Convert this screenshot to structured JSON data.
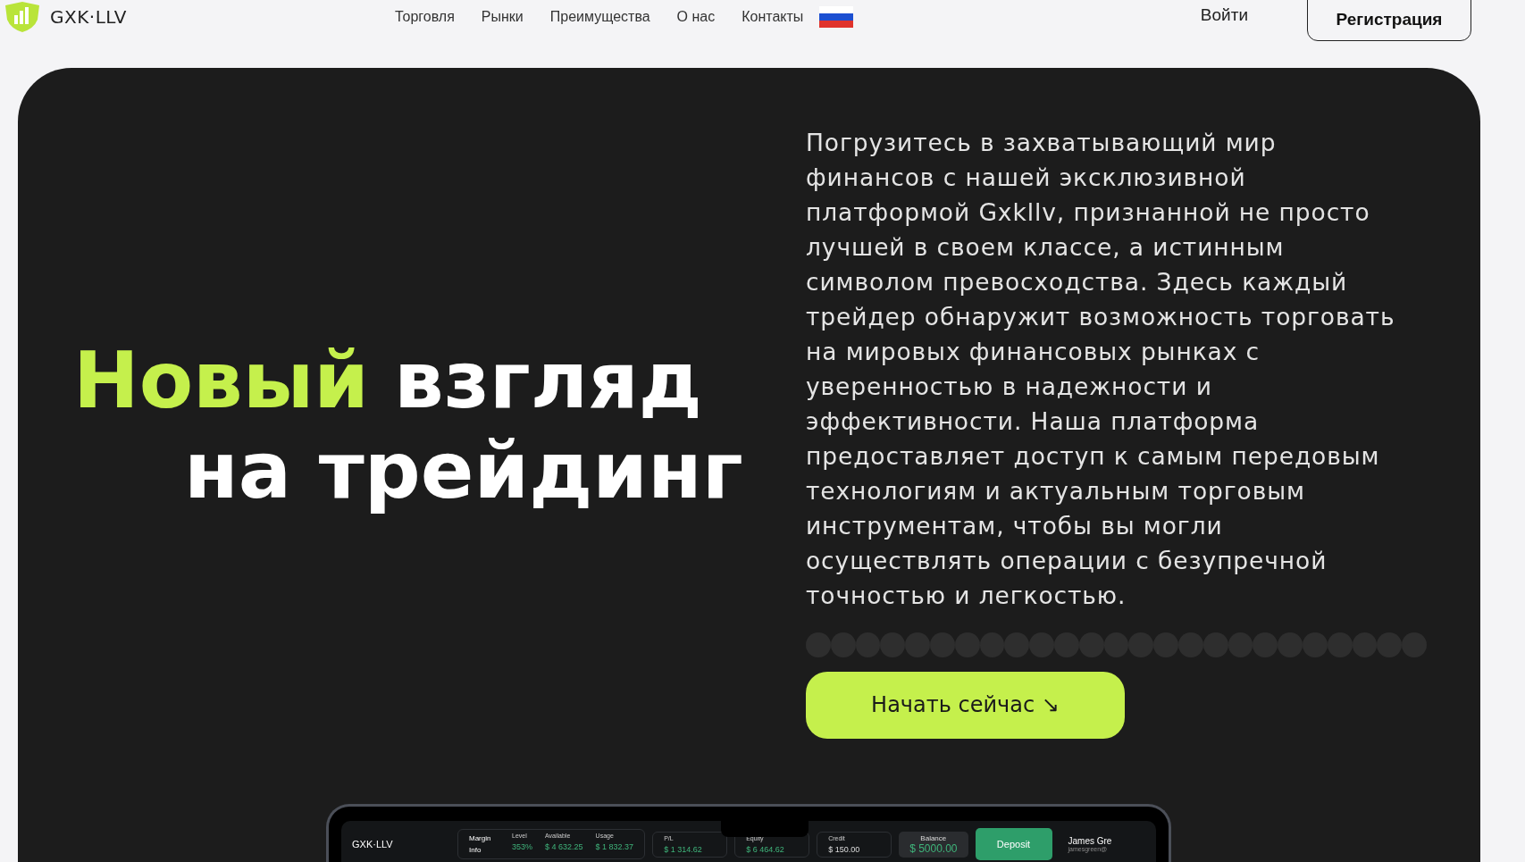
{
  "header": {
    "logo": "GXK·LLV",
    "nav": [
      {
        "label": "Торговля"
      },
      {
        "label": "Рынки"
      },
      {
        "label": "Преимущества"
      },
      {
        "label": "О нас"
      },
      {
        "label": "Контакты"
      }
    ],
    "login": "Войти",
    "register": "Регистрация"
  },
  "hero": {
    "headline": [
      {
        "parts": [
          {
            "text": "Новый",
            "accent": true
          },
          {
            "text": "взгляд",
            "accent": false
          }
        ]
      },
      {
        "parts": [
          {
            "text": "на трейдинг",
            "accent": false
          }
        ]
      }
    ],
    "description": "Погрузитесь в захватывающий мир финансов с нашей эксклюзивной платформой Gxkllv, признанной не просто лучшей в своем классе, а истинным символом превосходства. Здесь каждый трейдер обнаружит возможность торговать на мировых финансовых рынках с уверенностью в надежности и эффективности. Наша платформа предоставляет доступ к самым передовым технологиям и актуальным торговым инструментам, чтобы вы могли осуществлять операции с безупречной точностью и легкостью.",
    "cta": "Начать сейчас ↘"
  },
  "app_preview": {
    "logo": "GXK·LLV",
    "margin_label": "Margin Info",
    "stats": [
      {
        "label": "Level",
        "value": "353%"
      },
      {
        "label": "Available",
        "value": "$ 4 632.25"
      },
      {
        "label": "Usage",
        "value": "$ 1 832.37"
      }
    ],
    "cards": [
      {
        "label": "P/L",
        "value": "$ 1 314.62",
        "kind": "green"
      },
      {
        "label": "Equity",
        "value": "$ 6 464.62",
        "kind": "green"
      },
      {
        "label": "Credit",
        "value": "$ 150.00",
        "kind": "plain"
      }
    ],
    "balance_label": "Balance",
    "balance": "$ 5000.00",
    "deposit": "Deposit",
    "user_name": "James Gre",
    "user_email": "jamesgreen@"
  }
}
